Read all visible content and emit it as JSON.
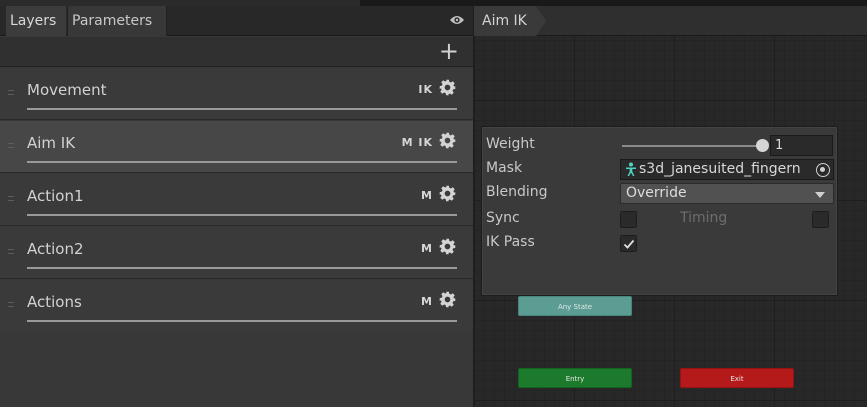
{
  "left_panel": {
    "tabs": [
      {
        "label": "Layers",
        "active": true
      },
      {
        "label": "Parameters",
        "active": false
      }
    ],
    "add_label": "+",
    "layers": [
      {
        "name": "Movement",
        "flags": "IK",
        "selected": false
      },
      {
        "name": "Aim IK",
        "flags": "M IK",
        "selected": true
      },
      {
        "name": "Action1",
        "flags": "M",
        "selected": false
      },
      {
        "name": "Action2",
        "flags": "M",
        "selected": false
      },
      {
        "name": "Actions",
        "flags": "M",
        "selected": false
      }
    ]
  },
  "graph": {
    "breadcrumb": "Aim IK",
    "nodes": {
      "any_state": "Any State",
      "entry": "Entry",
      "exit": "Exit"
    },
    "node_colors": {
      "any_state": "#5b9c93",
      "entry": "#1b7a2b",
      "exit": "#b41a1a"
    }
  },
  "layer_settings": {
    "weight_label": "Weight",
    "weight_value": "1",
    "weight_fraction": 1,
    "mask_label": "Mask",
    "mask_value": "s3d_janesuited_fingern",
    "blending_label": "Blending",
    "blending_value": "Override",
    "sync_label": "Sync",
    "sync_checked": false,
    "timing_label": "Timing",
    "timing_checked": false,
    "ik_pass_label": "IK Pass",
    "ik_pass_checked": true
  },
  "icons": {
    "visibility": "eye-icon",
    "layer_settings": "gear-icon",
    "mask_asset": "avatar-mask-icon",
    "object_picker": "object-picker-icon"
  },
  "colors": {
    "accent_mask_icon": "#4fd3c4"
  }
}
